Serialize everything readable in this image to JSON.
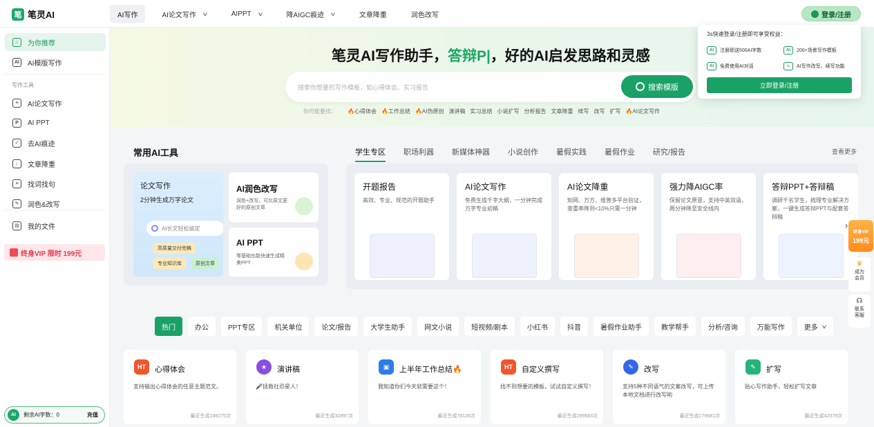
{
  "brand": {
    "name": "笔灵AI",
    "logo_mark": "笔",
    "accent": "#1aa266"
  },
  "nav": [
    {
      "label": "AI写作",
      "active": true,
      "dropdown": false
    },
    {
      "label": "AI论文写作",
      "dropdown": true
    },
    {
      "label": "AIPPT",
      "dropdown": true
    },
    {
      "label": "降AIGC痕迹",
      "dropdown": true
    },
    {
      "label": "文章降重",
      "dropdown": false
    },
    {
      "label": "润色改写",
      "dropdown": false
    }
  ],
  "login_button": "登录/注册",
  "sidebar": {
    "items": [
      {
        "label": "为你推荐",
        "icon": "home-icon",
        "glyph": "⌂"
      },
      {
        "label": "AI模版写作",
        "icon": "ai-template-icon",
        "glyph": "AI"
      }
    ],
    "section_title": "写作工具",
    "tools": [
      {
        "label": "AI论文写作",
        "icon": "paper-icon",
        "glyph": "≡"
      },
      {
        "label": "AI PPT",
        "icon": "ppt-icon",
        "glyph": "P"
      },
      {
        "label": "去AI痕迹",
        "icon": "remove-ai-icon",
        "glyph": "✓"
      },
      {
        "label": "文章降重",
        "icon": "reduce-icon",
        "glyph": "↓"
      },
      {
        "label": "找词找句",
        "icon": "find-icon",
        "glyph": "≡"
      },
      {
        "label": "润色&改写",
        "icon": "polish-icon",
        "glyph": "✎"
      },
      {
        "label": "我的文件",
        "icon": "file-icon",
        "glyph": "▤"
      }
    ],
    "vip": "终身VIP 限时 199元",
    "credits_label": "剩余AI字数：0",
    "credits_badge": "AI",
    "recharge": "充值"
  },
  "hero": {
    "title_a": "笔灵AI写作助手，",
    "title_g": "答辩P|",
    "title_b": "，好的AI启发思路和灵感",
    "search_placeholder": "搜索你想要的写作模板，如心得体会、实习报告",
    "search_button": "搜索模版",
    "hot_label": "你可能要找：",
    "hot": [
      "🔥心得体会",
      "🔥工作总结",
      "🔥AI伪原创",
      "演讲稿",
      "实习总结",
      "小说扩写",
      "分析报告",
      "文章降重",
      "续写",
      "改写",
      "扩写",
      "🔥AI论文写作"
    ]
  },
  "popup": {
    "title": "3s快速登录/注册即可享受权益：",
    "perks": [
      {
        "text": "注册即送500AI字数",
        "icon": "ai-credit-icon",
        "glyph": "AI"
      },
      {
        "text": "200+场景写作模板",
        "icon": "template-icon",
        "glyph": "AI"
      },
      {
        "text": "免费使用AI对话",
        "icon": "chat-icon",
        "glyph": "AI"
      },
      {
        "text": "AI写作改写、续写功能",
        "icon": "pen-icon",
        "glyph": "✎"
      }
    ],
    "button": "立即登录/注册"
  },
  "common_tools": {
    "title": "常用AI工具",
    "big": {
      "title": "论文写作",
      "subtitle": "2分钟生成万字论文",
      "chip": "AI长文轻松搞定",
      "tags": [
        "高质量交付完稿",
        "专业知识库",
        "原创文章"
      ]
    },
    "small": [
      {
        "title": "AI润色改写",
        "desc": "润色+改写，可比原文更好的原创文章"
      },
      {
        "title": "AI PPT",
        "desc": "零基础也能快速生成精美PPT"
      }
    ]
  },
  "tabs": [
    "学生专区",
    "职场利器",
    "新媒体神器",
    "小说创作",
    "暑假实践",
    "暑假作业",
    "研究/报告"
  ],
  "see_more": "查看更多",
  "tool_cards": [
    {
      "title": "开题报告",
      "desc": "高效、专业、规范的开题助手"
    },
    {
      "title": "AI论文写作",
      "desc": "免费生成千字大纲，一分钟完成万字专业初稿"
    },
    {
      "title": "AI论文降重",
      "desc": "知网、万方、维普多平台验证，查重率降到<10%只需一分钟"
    },
    {
      "title": "强力降AIGC率",
      "desc": "保留论文原意，支持中英双语，两分钟降至安全线内"
    },
    {
      "title": "答辩PPT+答辩稿",
      "desc": "调研千名学生，梳理专业解决方案，一键生成答辩PPT与配套答辩稿"
    }
  ],
  "floating": {
    "vip_top": "终身VIP",
    "vip_price": "199元",
    "member": "成为会员",
    "service": "联系客服"
  },
  "categories": [
    "热门",
    "办公",
    "PPT专区",
    "机关单位",
    "论文/报告",
    "大学生助手",
    "网文小说",
    "短视频/剧本",
    "小红书",
    "抖音",
    "暑假作业助手",
    "教学帮手",
    "分析/咨询",
    "万能写作",
    "更多"
  ],
  "templates": [
    {
      "title": "心得体会",
      "desc": "支持输出心得体会的任意主题范文。",
      "count": "最近生成188275次",
      "color": "#f2552c",
      "glyph": "HT",
      "icon": "fire-icon"
    },
    {
      "title": "演讲稿",
      "desc": "🎤拯救社恐星人！",
      "count": "最近生成32897次",
      "color": "#8a4fe0",
      "glyph": "★",
      "icon": "speech-icon"
    },
    {
      "title": "上半年工作总结🔥",
      "desc": "我知道你们今天就需要这个！",
      "count": "最近生成78126次",
      "color": "#2b7de9",
      "glyph": "▣",
      "icon": "briefcase-icon"
    },
    {
      "title": "自定义撰写",
      "desc": "找不到想要的模板，试试自定义撰写！",
      "count": "最近生成289583次",
      "color": "#f2552c",
      "glyph": "HT",
      "icon": "custom-write-icon"
    },
    {
      "title": "改写",
      "desc": "支持5种不同语气的文案改写，可上传本地文档进行改写哟",
      "count": "最近生成179681次",
      "color": "#3466e8",
      "glyph": "✎",
      "icon": "rewrite-icon"
    },
    {
      "title": "扩写",
      "desc": "贴心写作助手，轻松扩写文章",
      "count": "最近生成42079次",
      "color": "#25b47b",
      "glyph": "✎",
      "icon": "expand-icon"
    }
  ]
}
